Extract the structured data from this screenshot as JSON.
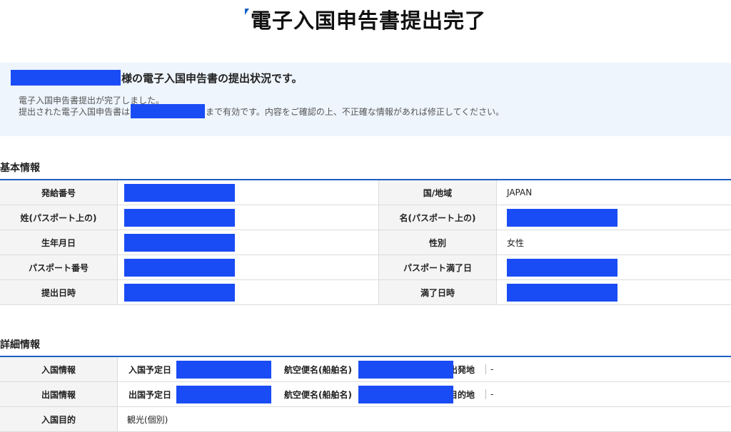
{
  "page": {
    "title": "電子入国申告書提出完了"
  },
  "notice": {
    "headline_suffix": "様の電子入国申告書の提出状況です。",
    "line1": "電子入国申告書提出が完了しました。",
    "line2_prefix": "提出された電子入国申告書は",
    "line2_suffix": "まで有効です。内容をご確認の上、不正確な情報があれば修正してください。"
  },
  "basic_info": {
    "section_title": "基本情報",
    "rows": [
      {
        "label_left": "発給番号",
        "value_left": "",
        "label_right": "国/地域",
        "value_right": "JAPAN"
      },
      {
        "label_left": "姓(パスポート上の)",
        "value_left": "",
        "label_right": "名(パスポート上の)",
        "value_right": ""
      },
      {
        "label_left": "生年月日",
        "value_left": "",
        "label_right": "性別",
        "value_right": "女性"
      },
      {
        "label_left": "パスポート番号",
        "value_left": "",
        "label_right": "パスポート満了日",
        "value_right": ""
      },
      {
        "label_left": "提出日時",
        "value_left": "",
        "label_right": "満了日時",
        "value_right": ""
      }
    ]
  },
  "detail_info": {
    "section_title": "詳細情報",
    "entry": {
      "label": "入国情報",
      "date_label": "入国予定日",
      "flight_label": "航空便名(船舶名)",
      "place_label": "出発地",
      "place_value": "-"
    },
    "exit": {
      "label": "出国情報",
      "date_label": "出国予定日",
      "flight_label": "航空便名(船舶名)",
      "place_label": "目的地",
      "place_value": "-"
    },
    "purpose": {
      "label": "入国目的",
      "value": "観光(個別)"
    }
  },
  "colors": {
    "redaction": "#1a4cf5",
    "accent": "#1c5fc0",
    "notice_bg": "#eef5fd"
  }
}
